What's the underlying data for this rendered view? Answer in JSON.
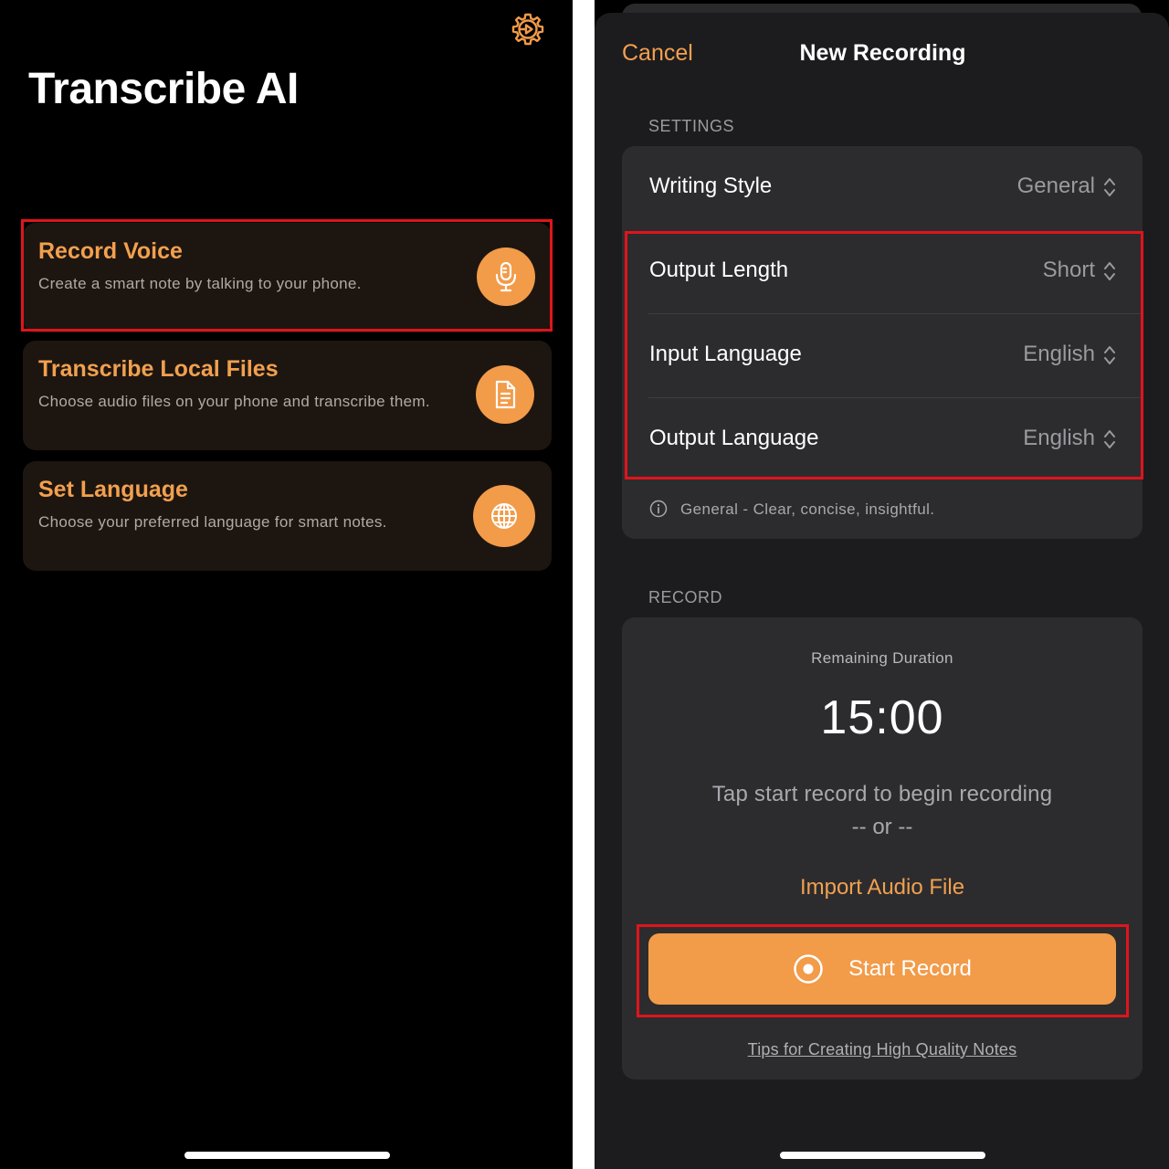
{
  "left_screen": {
    "app_title": "Transcribe AI",
    "settings_icon": "gear-icon",
    "cards": [
      {
        "title": "Record Voice",
        "description": "Create a smart note by talking to your phone.",
        "icon": "microphone-icon"
      },
      {
        "title": "Transcribe Local Files",
        "description": "Choose audio files on your phone and transcribe them.",
        "icon": "document-icon"
      },
      {
        "title": "Set Language",
        "description": "Choose your preferred language for smart notes.",
        "icon": "globe-icon"
      }
    ]
  },
  "right_screen": {
    "nav": {
      "cancel_label": "Cancel",
      "title": "New Recording"
    },
    "settings": {
      "header": "SETTINGS",
      "rows": [
        {
          "label": "Writing Style",
          "value": "General"
        },
        {
          "label": "Output Length",
          "value": "Short"
        },
        {
          "label": "Input Language",
          "value": "English"
        },
        {
          "label": "Output Language",
          "value": "English"
        }
      ],
      "info_text": "General - Clear, concise, insightful."
    },
    "record": {
      "header": "RECORD",
      "remaining_label": "Remaining Duration",
      "timer": "15:00",
      "hint": "Tap start record to begin recording",
      "or_text": "-- or --",
      "import_label": "Import Audio File",
      "start_label": "Start Record",
      "tips_label": "Tips for Creating High Quality Notes"
    }
  },
  "colors": {
    "accent": "#f29b49",
    "accent_text": "#f2a04f",
    "highlight": "#e0141c",
    "card_bg": "#1d1610",
    "group_bg": "#2c2c2e",
    "sheet_bg": "#1c1c1e"
  }
}
